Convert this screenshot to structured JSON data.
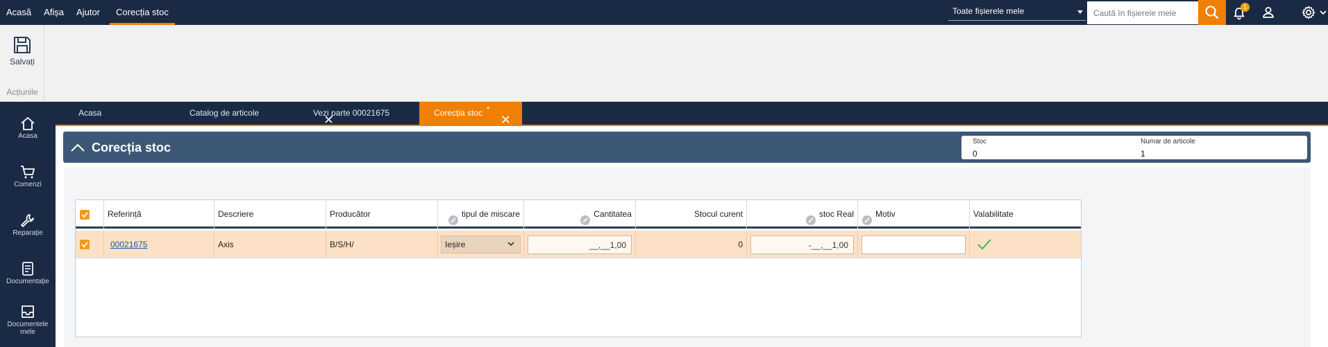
{
  "topnav": {
    "items": [
      "Acasă",
      "Afișa",
      "Ajutor",
      "Corecția stoc"
    ],
    "active_index": 3
  },
  "search": {
    "scope_label": "Toate fișierele mele",
    "placeholder": "Caută în fișierele mele"
  },
  "notifications": {
    "count": "1"
  },
  "ribbon": {
    "save_label": "Salvați",
    "group_label": "Acțiunile"
  },
  "sidebar": {
    "items": [
      {
        "label": "Acasa",
        "icon": "home-icon"
      },
      {
        "label": "Comenzi",
        "icon": "cart-icon"
      },
      {
        "label": "Reparație",
        "icon": "wrench-icon"
      },
      {
        "label": "Documentație",
        "icon": "document-icon"
      },
      {
        "label": "Documentele mele",
        "icon": "inbox-icon"
      }
    ]
  },
  "tabs": [
    {
      "label": "Acasa",
      "closable": false
    },
    {
      "label": "Catalog de articole",
      "closable": true
    },
    {
      "label": "Vezi parte 00021675",
      "closable": true
    },
    {
      "label": "Corecția stoc",
      "closable": true,
      "modified_mark": "*",
      "active": true
    }
  ],
  "panel": {
    "title": "Corecția stoc",
    "kpis": [
      {
        "label": "Stoc",
        "value": "0"
      },
      {
        "label": "Numar de articole",
        "value": "1"
      }
    ]
  },
  "table": {
    "columns": [
      "Referință",
      "Descriere",
      "Producător",
      "tipul de miscare",
      "Cantitatea",
      "Stocul curent",
      "stoc Real",
      "Motiv",
      "Valabilitate"
    ],
    "rows": [
      {
        "selected": true,
        "reference": "00021675",
        "description": "Axis",
        "manufacturer": "B/S/H/",
        "movement_type": "Ieșire",
        "quantity": "__,__1,00",
        "current_stock": "0",
        "real_stock": "-__,__1,00",
        "reason": "",
        "validity": "valid-check-icon"
      }
    ]
  },
  "colors": {
    "nav_bg": "#1b2a44",
    "accent": "#f07f06",
    "panel_header": "#3d5776",
    "row_highlight": "#fce1c6",
    "valid_green": "#4caf50"
  }
}
